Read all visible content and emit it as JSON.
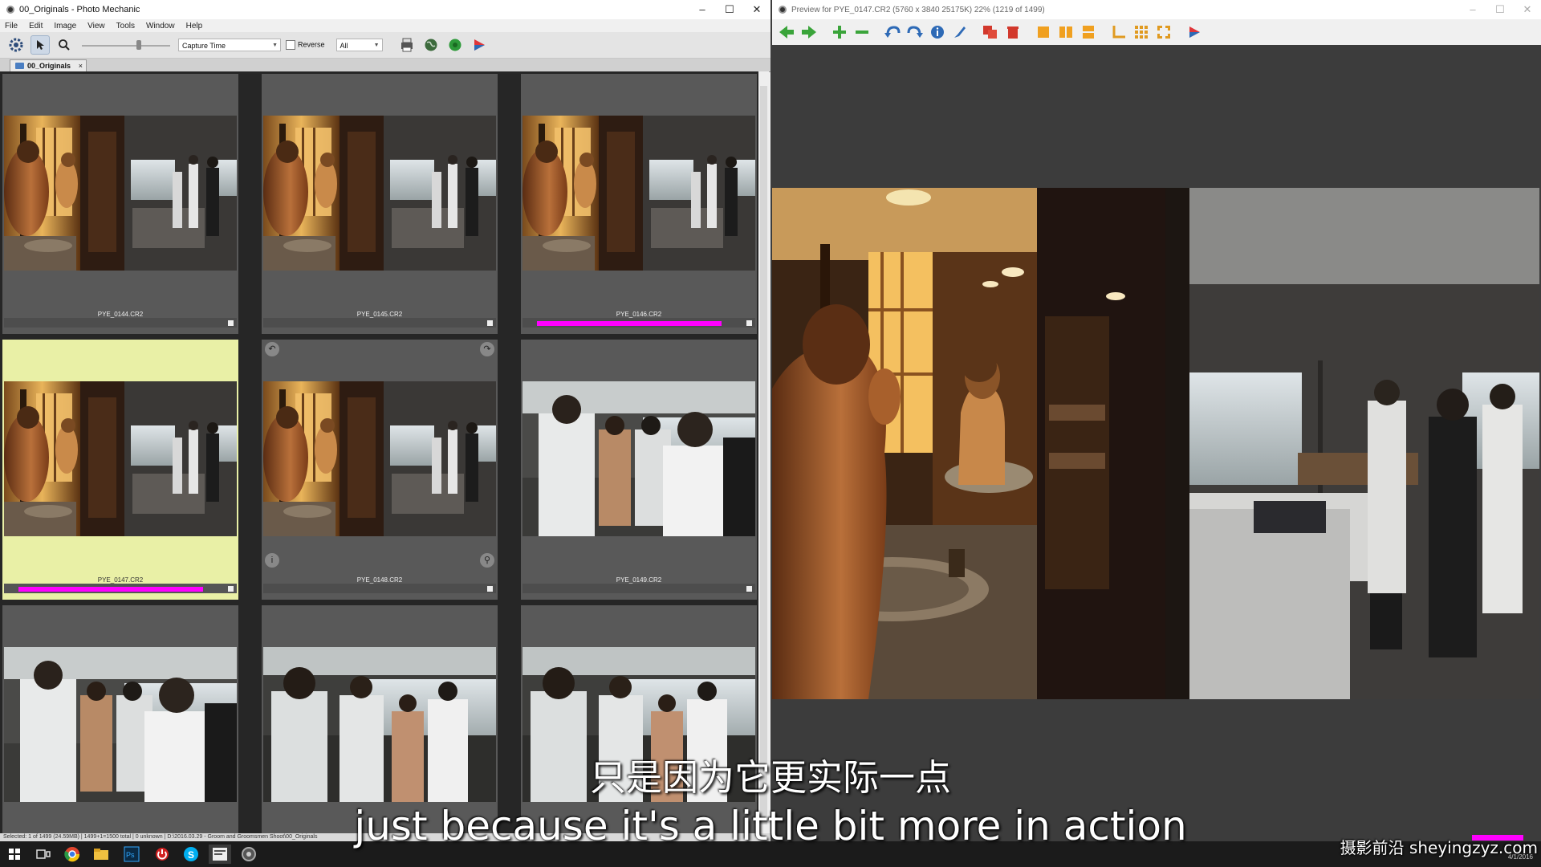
{
  "left_window": {
    "title": "00_Originals - Photo Mechanic",
    "menu": [
      "File",
      "Edit",
      "Image",
      "View",
      "Tools",
      "Window",
      "Help"
    ],
    "toolbar": {
      "sort_value": "Capture Time",
      "reverse_label": "Reverse",
      "filter_value": "All"
    },
    "tab_label": "00_Originals",
    "thumbnails": [
      {
        "filename": "PYE_0144.CR2",
        "selected": false,
        "color_class": ""
      },
      {
        "filename": "PYE_0145.CR2",
        "selected": false,
        "color_class": ""
      },
      {
        "filename": "PYE_0146.CR2",
        "selected": false,
        "color_class": "#ff00ff"
      },
      {
        "filename": "PYE_0147.CR2",
        "selected": true,
        "color_class": "#ff00ff"
      },
      {
        "filename": "PYE_0148.CR2",
        "selected": false,
        "color_class": ""
      },
      {
        "filename": "PYE_0149.CR2",
        "selected": false,
        "color_class": ""
      },
      {
        "filename": "",
        "selected": false,
        "color_class": ""
      },
      {
        "filename": "",
        "selected": false,
        "color_class": ""
      },
      {
        "filename": "",
        "selected": false,
        "color_class": ""
      }
    ],
    "status_text": "Selected: 1 of 1499 (24.59MB) | 1499+1=1500 total | 0 unknown | D:\\2016.03.29 - Groom and Groomsmen Shoot\\00_Originals"
  },
  "right_window": {
    "title": "Preview for PYE_0147.CR2 (5760 x 3840 25175K) 22% (1219 of 1499)",
    "toolbar_icons": [
      "arrow-left-icon",
      "arrow-right-icon",
      "zoom-in-icon",
      "zoom-out-icon",
      "rotate-left-icon",
      "rotate-right-icon",
      "info-icon",
      "edit-brush-icon",
      "copy-icon",
      "delete-icon",
      "layout-single-icon",
      "layout-double-icon",
      "layout-stack-icon",
      "crop-icon",
      "grid-icon",
      "fit-icon",
      "share-icon"
    ]
  },
  "taskbar": {
    "date": "4/1/2016"
  },
  "subtitles": {
    "chinese": "只是因为它更实际一点",
    "english": "just because it's a little bit more in action"
  },
  "watermark": "摄影前沿 sheyingzyz.com",
  "colors": {
    "color_class_magenta": "#ff00ff",
    "selected_cell": "#e9f0a6",
    "cell_bg": "#595959",
    "sheet_bg": "#262626"
  }
}
